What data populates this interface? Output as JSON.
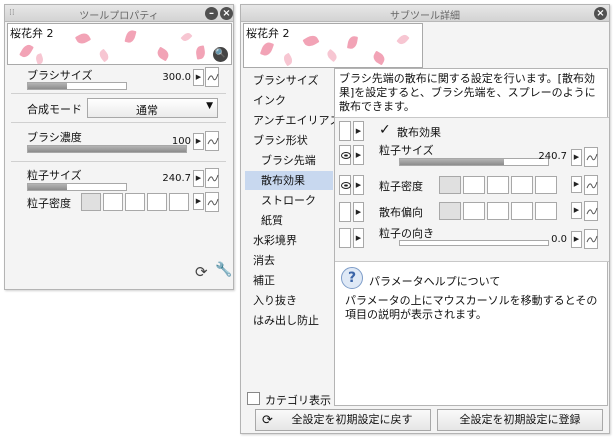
{
  "tool_property": {
    "title": "ツールプロパティ",
    "brush_name": "桜花弁 2",
    "brush_size": {
      "label": "ブラシサイズ",
      "value": "300.0",
      "fraction": 0.4
    },
    "blend_mode": {
      "label": "合成モード",
      "value": "通常"
    },
    "brush_density": {
      "label": "ブラシ濃度",
      "value": "100",
      "fraction": 1.0
    },
    "particle_size": {
      "label": "粒子サイズ",
      "value": "240.7",
      "fraction": 0.4
    },
    "particle_density": {
      "label": "粒子密度"
    },
    "footer_icons": [
      "reset-icon",
      "wrench-icon"
    ]
  },
  "sub_tool_detail": {
    "title": "サブツール詳細",
    "brush_name": "桜花弁 2",
    "categories": [
      {
        "label": "ブラシサイズ",
        "sub": false,
        "selected": false
      },
      {
        "label": "インク",
        "sub": false,
        "selected": false
      },
      {
        "label": "アンチエイリアス",
        "sub": false,
        "selected": false
      },
      {
        "label": "ブラシ形状",
        "sub": false,
        "selected": false
      },
      {
        "label": "ブラシ先端",
        "sub": true,
        "selected": false
      },
      {
        "label": "散布効果",
        "sub": true,
        "selected": true
      },
      {
        "label": "ストローク",
        "sub": true,
        "selected": false
      },
      {
        "label": "紙質",
        "sub": true,
        "selected": false
      },
      {
        "label": "水彩境界",
        "sub": false,
        "selected": false
      },
      {
        "label": "消去",
        "sub": false,
        "selected": false
      },
      {
        "label": "補正",
        "sub": false,
        "selected": false
      },
      {
        "label": "入り抜き",
        "sub": false,
        "selected": false
      },
      {
        "label": "はみ出し防止",
        "sub": false,
        "selected": false
      }
    ],
    "category_display": "カテゴリ表示",
    "description": "ブラシ先端の散布に関する設定を行います。[散布効果]を設定すると、ブラシ先端を、スプレーのように散布できます。",
    "scatter_effect": {
      "label": "散布効果",
      "checked": true
    },
    "particle_size": {
      "label": "粒子サイズ",
      "value": "240.7",
      "fraction": 0.7
    },
    "particle_density": {
      "label": "粒子密度"
    },
    "scatter_bias": {
      "label": "散布偏向"
    },
    "particle_direction": {
      "label": "粒子の向き",
      "value": "0.0",
      "fraction": 0.0
    },
    "help_title": "パラメータヘルプについて",
    "help_text": "パラメータの上にマウスカーソルを移動するとその項目の説明が表示されます。",
    "reset_all": "全設定を初期設定に戻す",
    "register_all": "全設定を初期設定に登録"
  },
  "colors": {
    "petal": "#f2a3b6",
    "selection": "#c8d8ef",
    "panel": "#f4f4f4"
  }
}
